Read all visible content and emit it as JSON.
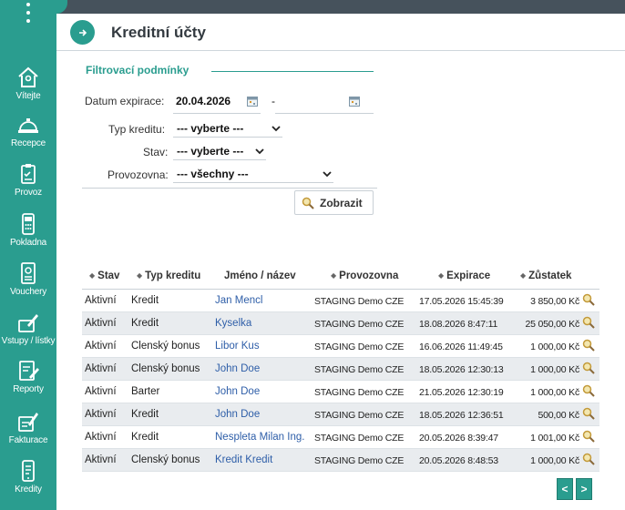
{
  "sidebar": {
    "menu_icon": "kebab-menu-icon",
    "items": [
      {
        "label": "Vítejte",
        "icon": "home-icon"
      },
      {
        "label": "Recepce",
        "icon": "bell-icon"
      },
      {
        "label": "Provoz",
        "icon": "clipboard-icon"
      },
      {
        "label": "Pokladna",
        "icon": "cash-register-icon"
      },
      {
        "label": "Vouchery",
        "icon": "voucher-icon"
      },
      {
        "label": "Vstupy / lístky",
        "icon": "ticket-icon"
      },
      {
        "label": "Reporty",
        "icon": "report-icon"
      },
      {
        "label": "Fakturace",
        "icon": "invoice-icon"
      },
      {
        "label": "Kredity",
        "icon": "phone-credit-icon"
      }
    ]
  },
  "header": {
    "title": "Kreditní účty",
    "toggle_icon": "arrow-right-icon"
  },
  "filters": {
    "title": "Filtrovací podmínky",
    "date_label": "Datum expirace:",
    "date_from": "20.04.2026",
    "date_separator": "-",
    "date_to": "",
    "credit_type_label": "Typ kreditu:",
    "credit_type_value": "--- vyberte ---",
    "state_label": "Stav:",
    "state_value": "--- vyberte ---",
    "branch_label": "Provozovna:",
    "branch_value": "--- všechny ---",
    "show_button": "Zobrazit"
  },
  "table": {
    "columns": [
      "Stav",
      "Typ kreditu",
      "Jméno / název",
      "Provozovna",
      "Expirace",
      "Zůstatek"
    ],
    "rows": [
      {
        "stav": "Aktivní",
        "typ": "Kredit",
        "jmeno": "Jan Mencl",
        "provozovna": "STAGING Demo CZE",
        "expirace": "17.05.2026 15:45:39",
        "zustatek": "3 850,00 Kč"
      },
      {
        "stav": "Aktivní",
        "typ": "Kredit",
        "jmeno": "Kyselka",
        "provozovna": "STAGING Demo CZE",
        "expirace": "18.08.2026 8:47:11",
        "zustatek": "25 050,00 Kč"
      },
      {
        "stav": "Aktivní",
        "typ": "Členský bonus",
        "jmeno": "Libor Kus",
        "provozovna": "STAGING Demo CZE",
        "expirace": "16.06.2026 11:49:45",
        "zustatek": "1 000,00 Kč"
      },
      {
        "stav": "Aktivní",
        "typ": "Členský bonus",
        "jmeno": "John Doe",
        "provozovna": "STAGING Demo CZE",
        "expirace": "18.05.2026 12:30:13",
        "zustatek": "1 000,00 Kč"
      },
      {
        "stav": "Aktivní",
        "typ": "Barter",
        "jmeno": "John Doe",
        "provozovna": "STAGING Demo CZE",
        "expirace": "21.05.2026 12:30:19",
        "zustatek": "1 000,00 Kč"
      },
      {
        "stav": "Aktivní",
        "typ": "Kredit",
        "jmeno": "John Doe",
        "provozovna": "STAGING Demo CZE",
        "expirace": "18.05.2026 12:36:51",
        "zustatek": "500,00 Kč"
      },
      {
        "stav": "Aktivní",
        "typ": "Kredit",
        "jmeno": "Nespleta Milan Ing.",
        "provozovna": "STAGING Demo CZE",
        "expirace": "20.05.2026 8:39:47",
        "zustatek": "1 001,00 Kč"
      },
      {
        "stav": "Aktivní",
        "typ": "Členský bonus",
        "jmeno": "Kredit Kredit",
        "provozovna": "STAGING Demo CZE",
        "expirace": "20.05.2026 8:48:53",
        "zustatek": "1 000,00 Kč"
      }
    ]
  },
  "pager": {
    "prev": "<",
    "next": ">"
  },
  "colors": {
    "accent": "#2a9d8f",
    "topbar": "#46525c",
    "link": "#2e5ea8",
    "row_alt": "#e9ecef"
  }
}
